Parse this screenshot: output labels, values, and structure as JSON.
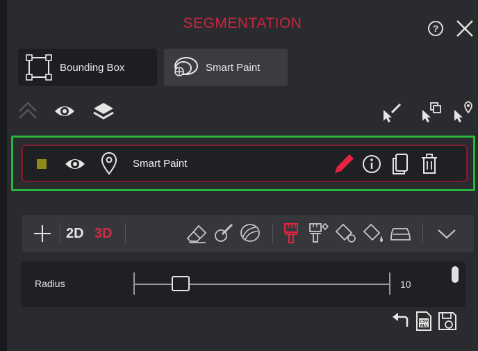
{
  "header": {
    "title": "SEGMENTATION",
    "help_glyph": "?",
    "icons": [
      "help-icon",
      "close-icon"
    ]
  },
  "modes": [
    {
      "label": "Bounding Box",
      "icon": "bounding-box-icon",
      "active": false
    },
    {
      "label": "Smart Paint",
      "icon": "smart-paint-icon",
      "active": true
    }
  ],
  "toolbar": {
    "left_icons": [
      "collapse-up-icon",
      "eye-icon",
      "layers-icon"
    ],
    "right_icons": [
      "pointer-pencil-icon",
      "pointer-box-icon",
      "pointer-pin-icon"
    ]
  },
  "layer": {
    "name": "Smart Paint",
    "swatch_color": "#8f8b18",
    "icons": [
      "eye-icon",
      "pin-icon",
      "pencil-icon",
      "info-icon",
      "copy-icon",
      "trash-icon"
    ]
  },
  "tools": {
    "label_2d": "2D",
    "label_3d": "3D",
    "icons": [
      "plus-icon",
      "eraser-icon",
      "brush-pencil-icon",
      "blob-icon",
      "paint-brush-icon",
      "brush-settings-icon",
      "fill-icon",
      "fill-drop-icon",
      "iron-icon",
      "chevron-down-icon"
    ]
  },
  "radius": {
    "label": "Radius",
    "value": "10",
    "min": 1,
    "max": 50
  },
  "footer": {
    "icons": [
      "undo-icon",
      "csv-all-icon",
      "save-icon"
    ],
    "csv_text": "CSV\nALL"
  },
  "colors": {
    "accent": "#c8263c",
    "highlight_border": "#27b53d",
    "layer_border": "#7d1e2e",
    "panel_bg": "#2a2b2e"
  }
}
